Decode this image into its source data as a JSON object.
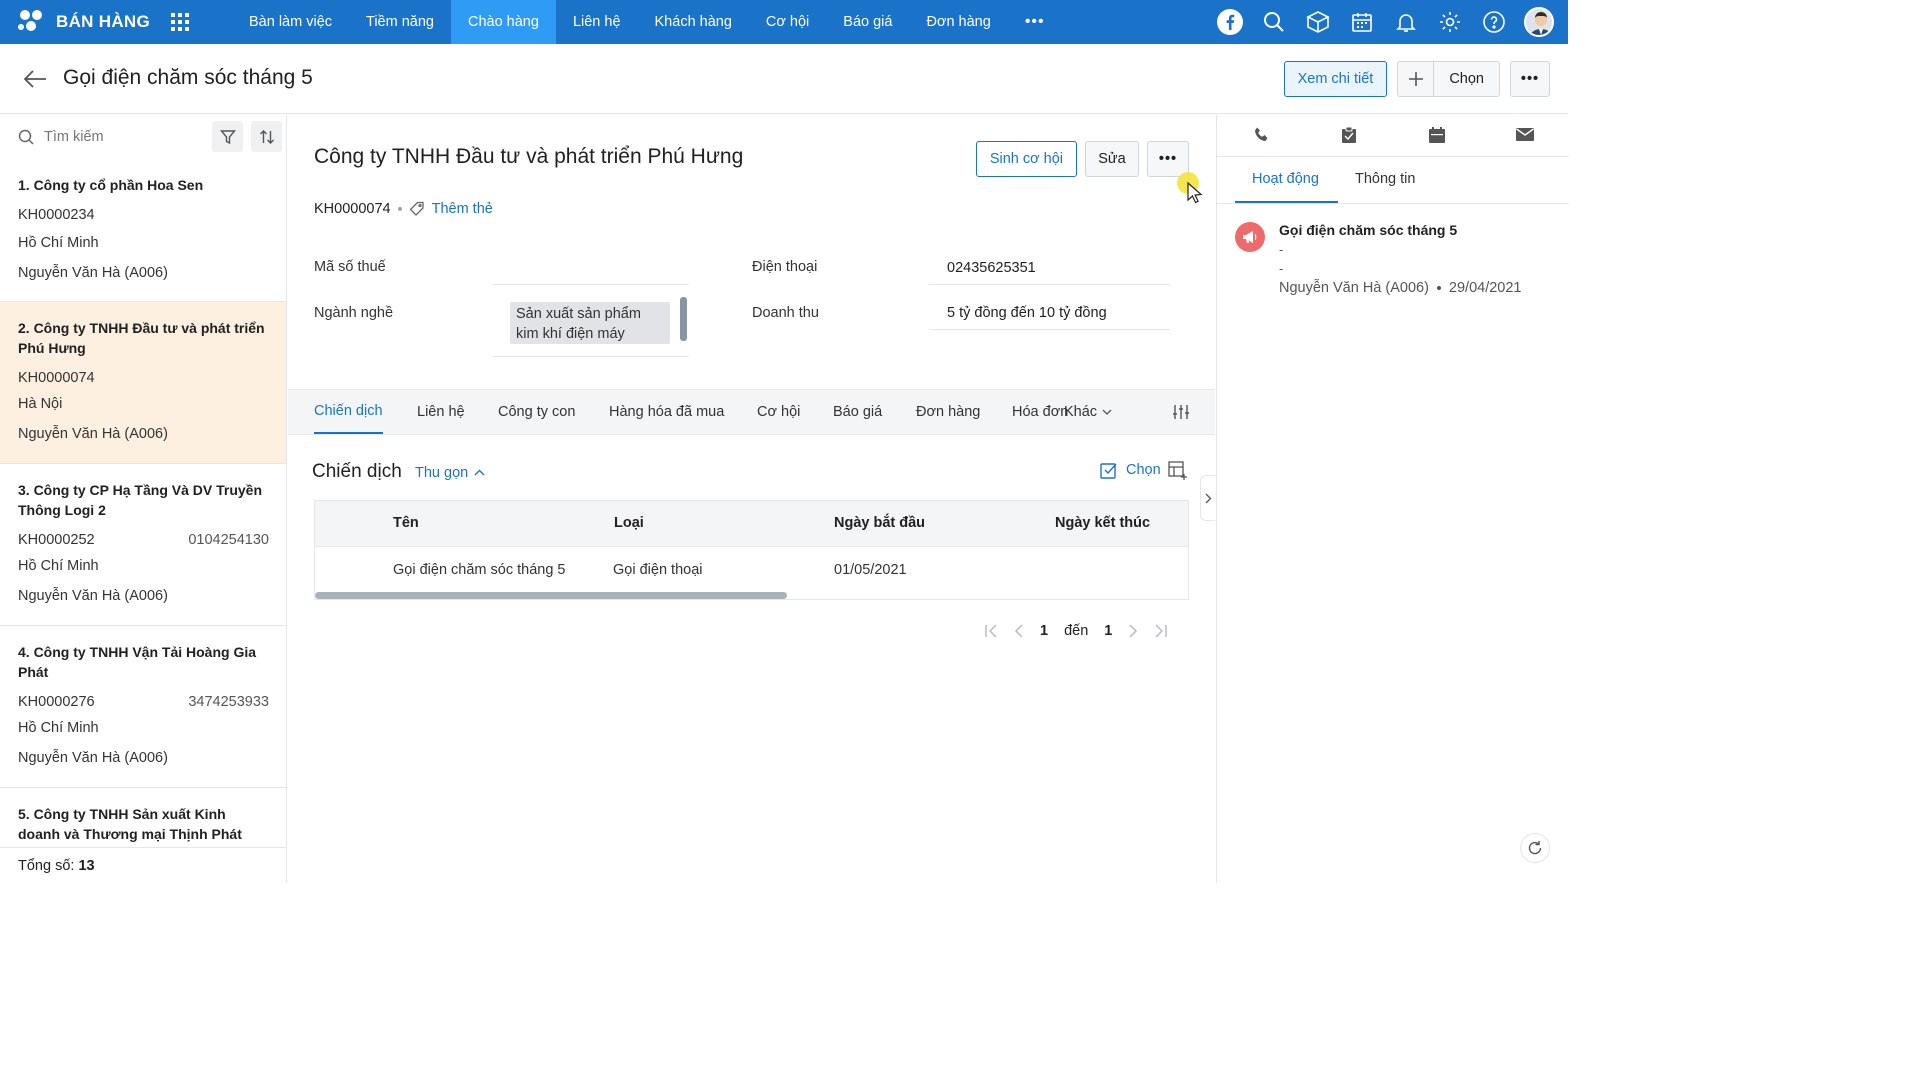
{
  "app": {
    "title": "BÁN HÀNG"
  },
  "nav": {
    "items": [
      {
        "label": "Bàn làm việc",
        "active": false
      },
      {
        "label": "Tiềm năng",
        "active": false
      },
      {
        "label": "Chào hàng",
        "active": true
      },
      {
        "label": "Liên hệ",
        "active": false
      },
      {
        "label": "Khách hàng",
        "active": false
      },
      {
        "label": "Cơ hội",
        "active": false
      },
      {
        "label": "Báo giá",
        "active": false
      },
      {
        "label": "Đơn hàng",
        "active": false
      }
    ],
    "more": "•••"
  },
  "top_icons": [
    "facebook-icon",
    "search-icon",
    "box-icon",
    "calendar-icon",
    "bell-icon",
    "gear-icon",
    "help-icon",
    "avatar"
  ],
  "header": {
    "title": "Gọi điện chăm sóc tháng 5",
    "view_detail": "Xem chi tiết",
    "choose": "Chọn",
    "more": "•••"
  },
  "sidebar": {
    "search_placeholder": "Tìm kiếm",
    "cards": [
      {
        "name": "1. Công ty cổ phần Hoa Sen",
        "code": "KH0000234",
        "phone": "",
        "city": "Hồ Chí Minh",
        "owner": "Nguyễn Văn Hà (A006)",
        "selected": false
      },
      {
        "name": "2. Công ty TNHH Đầu tư và phát triển Phú Hưng",
        "code": "KH0000074",
        "phone": "",
        "city": "Hà Nội",
        "owner": "Nguyễn Văn Hà (A006)",
        "selected": true
      },
      {
        "name": "3. Công ty CP Hạ Tầng Và DV Truyền Thông Logi 2",
        "code": "KH0000252",
        "phone": "0104254130",
        "city": "Hồ Chí Minh",
        "owner": "Nguyễn Văn Hà (A006)",
        "selected": false
      },
      {
        "name": "4. Công ty TNHH Vận Tải Hoàng Gia Phát",
        "code": "KH0000276",
        "phone": "3474253933",
        "city": "Hồ Chí Minh",
        "owner": "Nguyễn Văn Hà (A006)",
        "selected": false
      },
      {
        "name": "5. Công ty TNHH Sản xuất Kinh doanh và Thương mại Thịnh Phát",
        "code": "",
        "phone": "",
        "city": "",
        "owner": "",
        "selected": false
      }
    ],
    "total_label": "Tổng số:",
    "total_value": "13"
  },
  "record": {
    "title": "Công ty TNHH Đầu tư và phát triển Phú Hưng",
    "create_opportunity": "Sinh cơ hội",
    "edit": "Sửa",
    "more": "•••",
    "code": "KH0000074",
    "add_tag": "Thêm thẻ",
    "fields": {
      "tax_label": "Mã số thuế",
      "tax_value": "",
      "industry_label": "Ngành nghề",
      "industry_value": "Sản xuất sản phẩm kim khí điện máy",
      "phone_label": "Điện thoại",
      "phone_value": "02435625351",
      "revenue_label": "Doanh thu",
      "revenue_value": "5 tỷ đồng đến 10 tỷ đồng"
    }
  },
  "tabs": [
    {
      "label": "Chiến dịch",
      "active": true
    },
    {
      "label": "Liên hệ",
      "active": false
    },
    {
      "label": "Công ty con",
      "active": false
    },
    {
      "label": "Hàng hóa đã mua",
      "active": false
    },
    {
      "label": "Cơ hội",
      "active": false
    },
    {
      "label": "Báo giá",
      "active": false
    },
    {
      "label": "Đơn hàng",
      "active": false
    },
    {
      "label": "Hóa đơn",
      "active": false
    },
    {
      "label": "Khác",
      "active": false
    }
  ],
  "campaign": {
    "title": "Chiến dịch",
    "collapse": "Thu gọn",
    "choose": "Chọn",
    "columns": [
      "Tên",
      "Loại",
      "Ngày bắt đầu",
      "Ngày kết thúc"
    ],
    "rows": [
      {
        "name": "Gọi điện chăm sóc tháng 5",
        "type": "Gọi điện thoại",
        "start": "01/05/2021",
        "end": ""
      }
    ],
    "pager": {
      "current": "1",
      "to_label": "đến",
      "total": "1"
    }
  },
  "right_panel": {
    "icons": [
      "phone-icon",
      "task-icon",
      "calendar-icon",
      "mail-icon"
    ],
    "tabs": [
      {
        "label": "Hoạt động",
        "active": true
      },
      {
        "label": "Thông tin",
        "active": false
      }
    ],
    "activity": {
      "title": "Gọi điện chăm sóc tháng 5",
      "line1": "-",
      "line2": "-",
      "owner": "Nguyễn Văn Hà (A006)",
      "date": "29/04/2021"
    }
  },
  "colors": {
    "primary": "#1a73c8",
    "nav_active": "#2f9bf5",
    "selected_card": "#fdf0e0",
    "activity_icon": "#ee6b6b"
  }
}
